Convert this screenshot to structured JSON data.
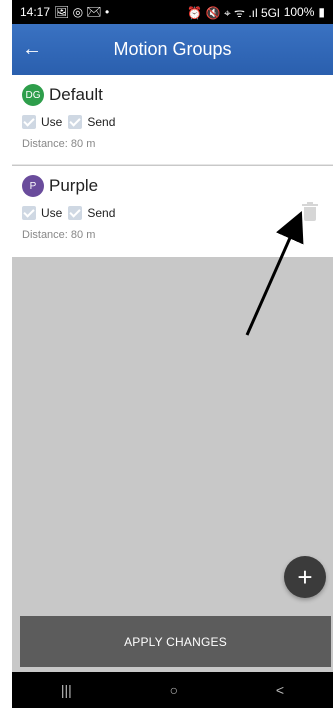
{
  "statusbar": {
    "time": "14:17",
    "left_icons": "🖼 ◎ ✉ •",
    "right_icons": "⏰ 🔇 ⌖ ᯤ .ıl 5Gl",
    "battery": "100%"
  },
  "appbar": {
    "back_icon": "←",
    "title": "Motion Groups"
  },
  "groups": [
    {
      "avatar": "DG",
      "avatar_color": "#2e9e4b",
      "name": "Default",
      "use_label": "Use",
      "send_label": "Send",
      "distance": "Distance: 80 m"
    },
    {
      "avatar": "P",
      "avatar_color": "#6a4c9c",
      "name": "Purple",
      "use_label": "Use",
      "send_label": "Send",
      "distance": "Distance: 80 m"
    }
  ],
  "fab": {
    "icon": "+"
  },
  "apply": {
    "label": "APPLY CHANGES"
  },
  "navbar": {
    "recents": "|||",
    "home": "○",
    "back": "<"
  }
}
